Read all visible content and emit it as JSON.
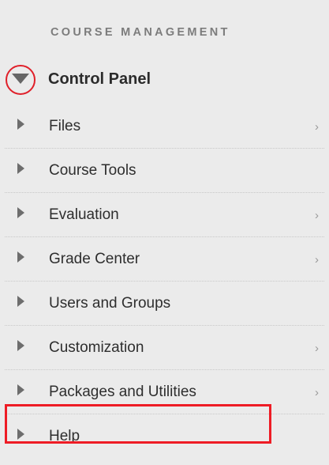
{
  "section_heading": "COURSE MANAGEMENT",
  "control_panel": {
    "label": "Control Panel",
    "icon": "triangle-down-icon",
    "annotation_color": "#e0202a"
  },
  "menu": {
    "items": [
      {
        "label": "Files",
        "chevron": "›",
        "has_chevron": true
      },
      {
        "label": "Course Tools",
        "chevron": "",
        "has_chevron": false
      },
      {
        "label": "Evaluation",
        "chevron": "›",
        "has_chevron": true
      },
      {
        "label": "Grade Center",
        "chevron": "›",
        "has_chevron": true
      },
      {
        "label": "Users and Groups",
        "chevron": "",
        "has_chevron": false
      },
      {
        "label": "Customization",
        "chevron": "›",
        "has_chevron": true
      },
      {
        "label": "Packages and Utilities",
        "chevron": "›",
        "has_chevron": true,
        "highlighted": true
      },
      {
        "label": "Help",
        "chevron": "",
        "has_chevron": false
      }
    ]
  },
  "colors": {
    "panel_bg": "#ebebeb",
    "highlight": "#ee1c25",
    "text": "#2e2e2e",
    "heading": "#7c7c7c"
  }
}
